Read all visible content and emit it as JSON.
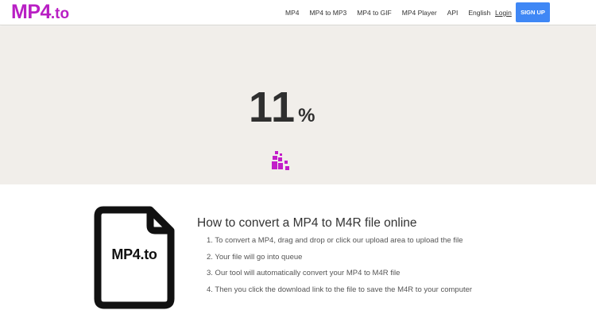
{
  "navbar": {
    "logo_main": "MP4",
    "logo_tld": ".to",
    "links": [
      "MP4",
      "MP4 to MP3",
      "MP4 to GIF",
      "MP4 Player",
      "API",
      "English"
    ],
    "login_label": "Login",
    "signup_label": "SIGN UP"
  },
  "progress": {
    "value": "11",
    "unit": "%"
  },
  "howto": {
    "file_icon_label": "MP4.to",
    "title": "How to convert a MP4 to M4R file online",
    "steps": [
      "1. To convert a MP4, drag and drop or click our upload area to upload the file",
      "2. Your file will go into queue",
      "3. Our tool will automatically convert your MP4 to M4R file",
      "4. Then you click the download link to the file to save the M4R to your computer"
    ]
  },
  "colors": {
    "brand": "#b91fc4",
    "signup_button": "#3f87f5",
    "panel_background": "#f1eeea",
    "loader": "#c21ec9"
  }
}
